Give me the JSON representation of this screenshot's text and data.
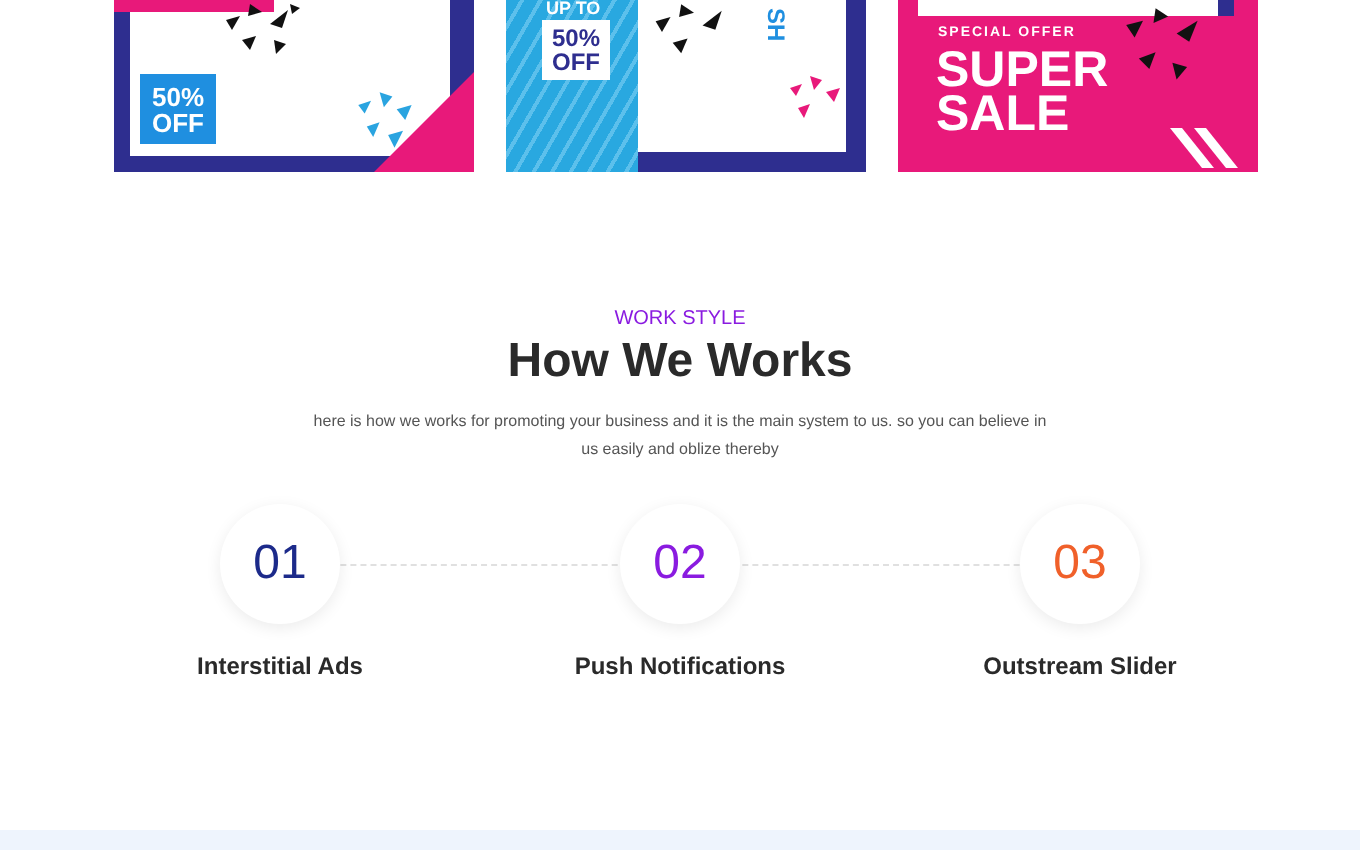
{
  "banners": [
    {
      "kind": "frame",
      "badge_lines": [
        "50%",
        "OFF"
      ]
    },
    {
      "kind": "split",
      "top_text": "UP TO",
      "badge_lines": [
        "50%",
        "OFF"
      ],
      "side_text": "SH"
    },
    {
      "kind": "sale",
      "eyebrow": "SPECIAL OFFER",
      "headline_lines": [
        "SUPER",
        "SALE"
      ]
    }
  ],
  "section": {
    "eyebrow": "WORK STYLE",
    "title": "How We Works",
    "description": "here is how we works for promoting your business and it is the main system to us. so you can believe in us easily and oblize thereby"
  },
  "steps": [
    {
      "number": "01",
      "label": "Interstitial Ads",
      "color": "#1c2a8a"
    },
    {
      "number": "02",
      "label": "Push Notifications",
      "color": "#8a1be0"
    },
    {
      "number": "03",
      "label": "Outstream Slider",
      "color": "#f0602a"
    }
  ]
}
